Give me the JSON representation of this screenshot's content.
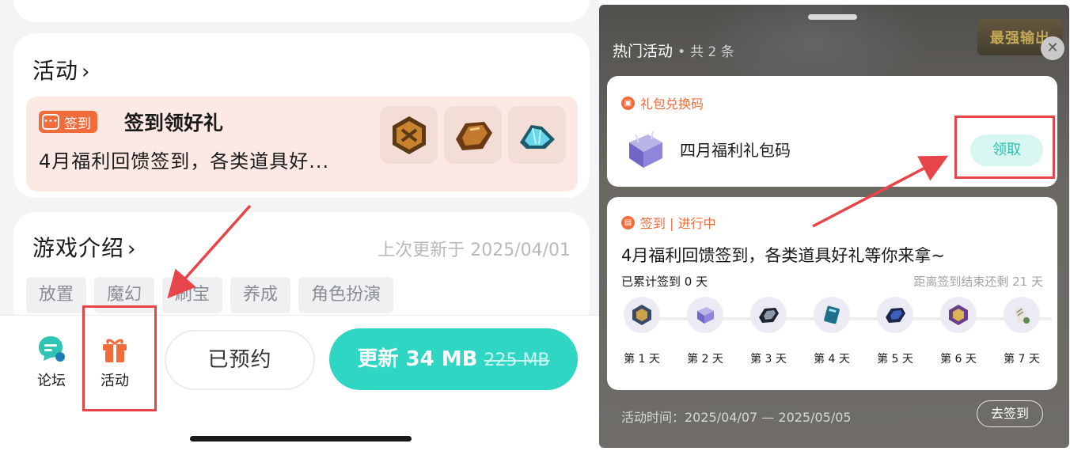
{
  "left": {
    "activity": {
      "title": "活动",
      "chevron": "›",
      "item": {
        "badge_label": "签到",
        "name": "签到领好礼",
        "description": "4月福利回馈签到，各类道具好..."
      }
    },
    "intro": {
      "title": "游戏介绍",
      "chevron": "›",
      "updated": "上次更新于 2025/04/01",
      "tags": [
        "放置",
        "魔幻",
        "刷宝",
        "养成",
        "角色扮演"
      ]
    },
    "bottom": {
      "forum_label": "论坛",
      "activity_label": "活动",
      "reserved_label": "已预约",
      "update_label": "更新 34 MB",
      "update_old_size": "225 MB"
    }
  },
  "right": {
    "header": {
      "title": "热门活动",
      "sep": "•",
      "count": "共 2 条",
      "bg_logo": "最强输出"
    },
    "gift_card": {
      "label": "礼包兑换码",
      "item_name": "四月福利礼包码",
      "claim_label": "领取"
    },
    "sign_card": {
      "label": "签到 | 进行中",
      "description": "4月福利回馈签到，各类道具好礼等你来拿~",
      "accumulated": "已累计签到 0 天",
      "remaining": "距离签到结束还剩 21 天",
      "days": [
        "第 1 天",
        "第 2 天",
        "第 3 天",
        "第 4 天",
        "第 5 天",
        "第 6 天",
        "第 7 天"
      ]
    },
    "footer": {
      "period": "活动时间：2025/04/07 — 2025/05/05",
      "go_sign_label": "去签到"
    }
  },
  "colors": {
    "accent_teal": "#2fd6c3",
    "accent_orange": "#f26b3a",
    "annotation_red": "#e8454a"
  }
}
